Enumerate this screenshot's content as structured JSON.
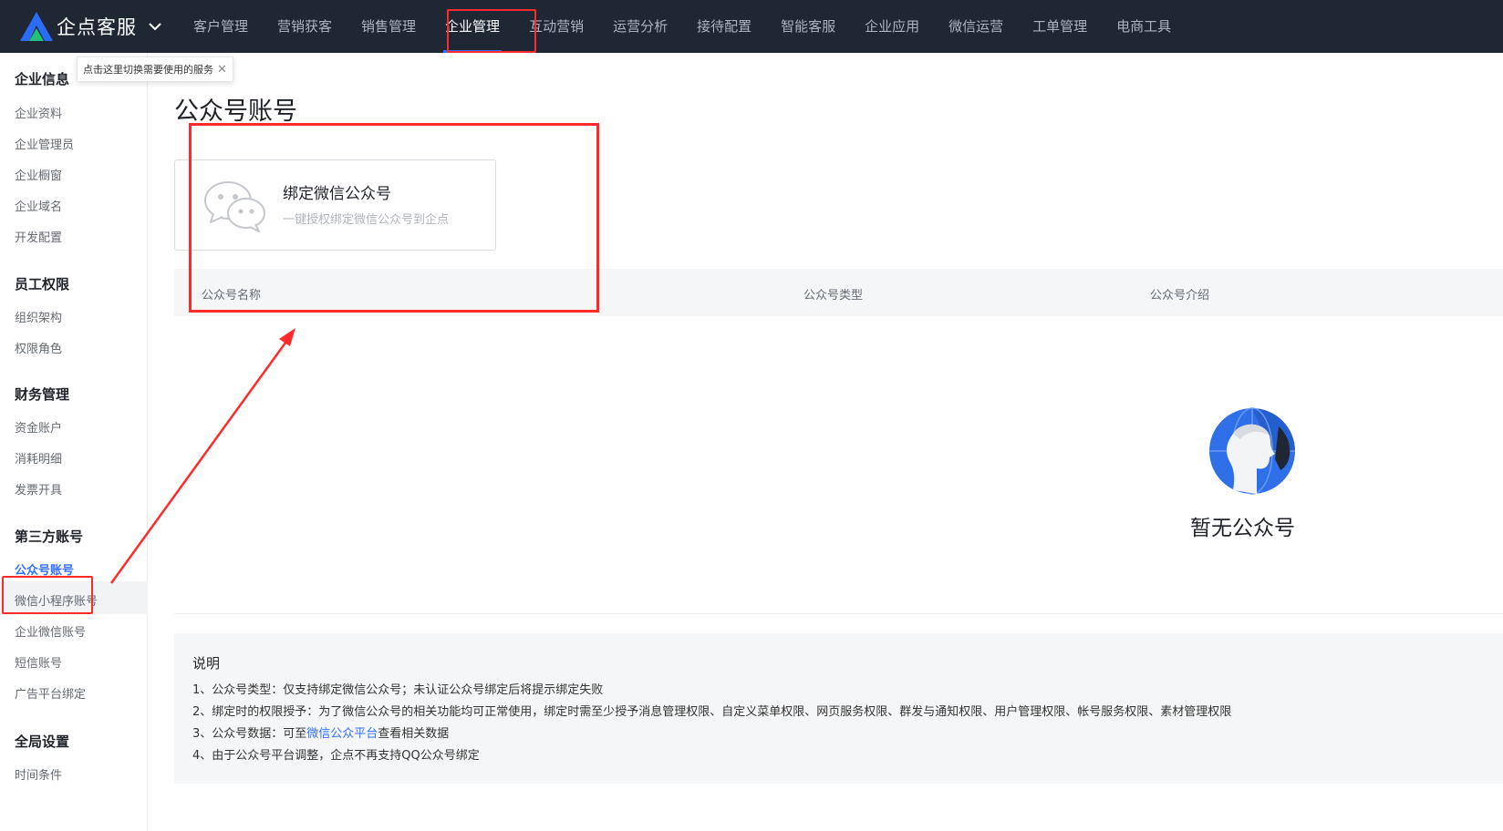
{
  "brand": {
    "name": "企点客服"
  },
  "nav": {
    "items": [
      {
        "label": "客户管理"
      },
      {
        "label": "营销获客"
      },
      {
        "label": "销售管理"
      },
      {
        "label": "企业管理"
      },
      {
        "label": "互动营销"
      },
      {
        "label": "运营分析"
      },
      {
        "label": "接待配置"
      },
      {
        "label": "智能客服"
      },
      {
        "label": "企业应用"
      },
      {
        "label": "微信运营"
      },
      {
        "label": "工单管理"
      },
      {
        "label": "电商工具"
      }
    ],
    "active": "企业管理"
  },
  "tooltip": {
    "text": "点击这里切换需要使用的服务"
  },
  "sidebar": {
    "groups": [
      {
        "title": "企业信息",
        "items": [
          "企业资料",
          "企业管理员",
          "企业橱窗",
          "企业域名",
          "开发配置"
        ]
      },
      {
        "title": "员工权限",
        "items": [
          "组织架构",
          "权限角色"
        ]
      },
      {
        "title": "财务管理",
        "items": [
          "资金账户",
          "消耗明细",
          "发票开具"
        ]
      },
      {
        "title": "第三方账号",
        "items": [
          "公众号账号",
          "微信小程序账号",
          "企业微信账号",
          "短信账号",
          "广告平台绑定"
        ]
      },
      {
        "title": "全局设置",
        "items": [
          "时间条件"
        ]
      }
    ],
    "active_item": "公众号账号"
  },
  "main": {
    "title": "公众号账号",
    "bind_card": {
      "title": "绑定微信公众号",
      "subtitle": "一键授权绑定微信公众号到企点",
      "icon": "wechat-icon"
    },
    "table": {
      "columns": [
        "公众号名称",
        "公众号类型",
        "公众号介绍"
      ]
    },
    "empty": {
      "text": "暂无公众号",
      "icon": "empty-person-globe-icon"
    },
    "notes": {
      "title": "说明",
      "items": [
        "1、公众号类型：仅支持绑定微信公众号；未认证公众号绑定后将提示绑定失败",
        "2、绑定时的权限授予：为了微信公众号的相关功能均可正常使用，绑定时需至少授予消息管理权限、自定义菜单权限、网页服务权限、群发与通知权限、用户管理权限、帐号服务权限、素材管理权限"
      ],
      "item3_prefix": "3、公众号数据：可至",
      "item3_link": "微信公众平台",
      "item3_suffix": "查看相关数据",
      "item4": "4、由于公众号平台调整，企点不再支持QQ公众号绑定"
    }
  },
  "colors": {
    "topbar": "#1f2634",
    "accent": "#3370ff",
    "annotation": "#ff2a2a"
  }
}
